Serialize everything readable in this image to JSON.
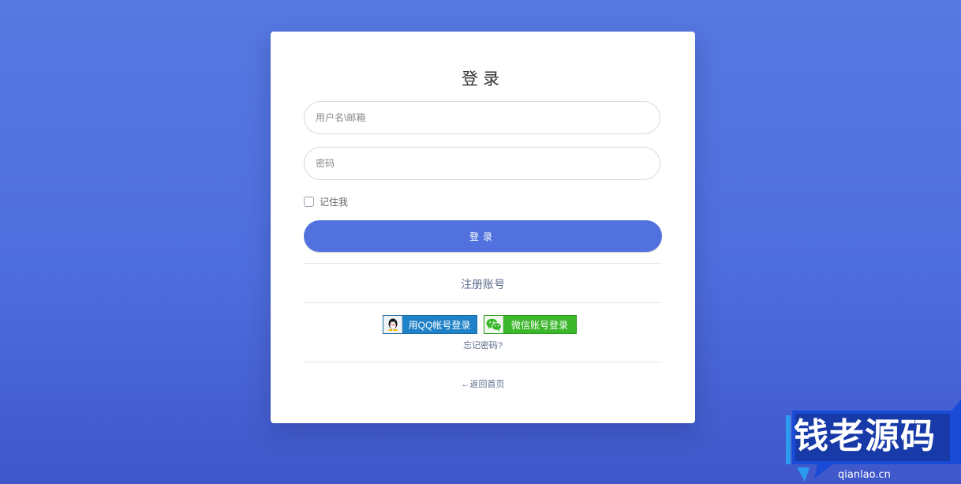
{
  "login": {
    "title": "登录",
    "username_placeholder": "用户名\\邮箱",
    "password_placeholder": "密码",
    "remember_label": "记住我",
    "submit_label": "登录",
    "register_link": "注册账号",
    "qq_login_label": "用QQ帐号登录",
    "wechat_login_label": "微信账号登录",
    "forgot_link": "忘记密码?",
    "back_link": "←返回首页"
  },
  "watermark": {
    "brand": "钱老源码",
    "domain": "qianlao.cn"
  },
  "colors": {
    "background": "#4f6ede",
    "accent": "#5172de",
    "qq_button": "#1f82c8",
    "wechat_button": "#3cb72c",
    "link": "#5e6b8c"
  },
  "icons": {
    "qq": "qq-penguin-icon",
    "wechat": "wechat-icon"
  }
}
